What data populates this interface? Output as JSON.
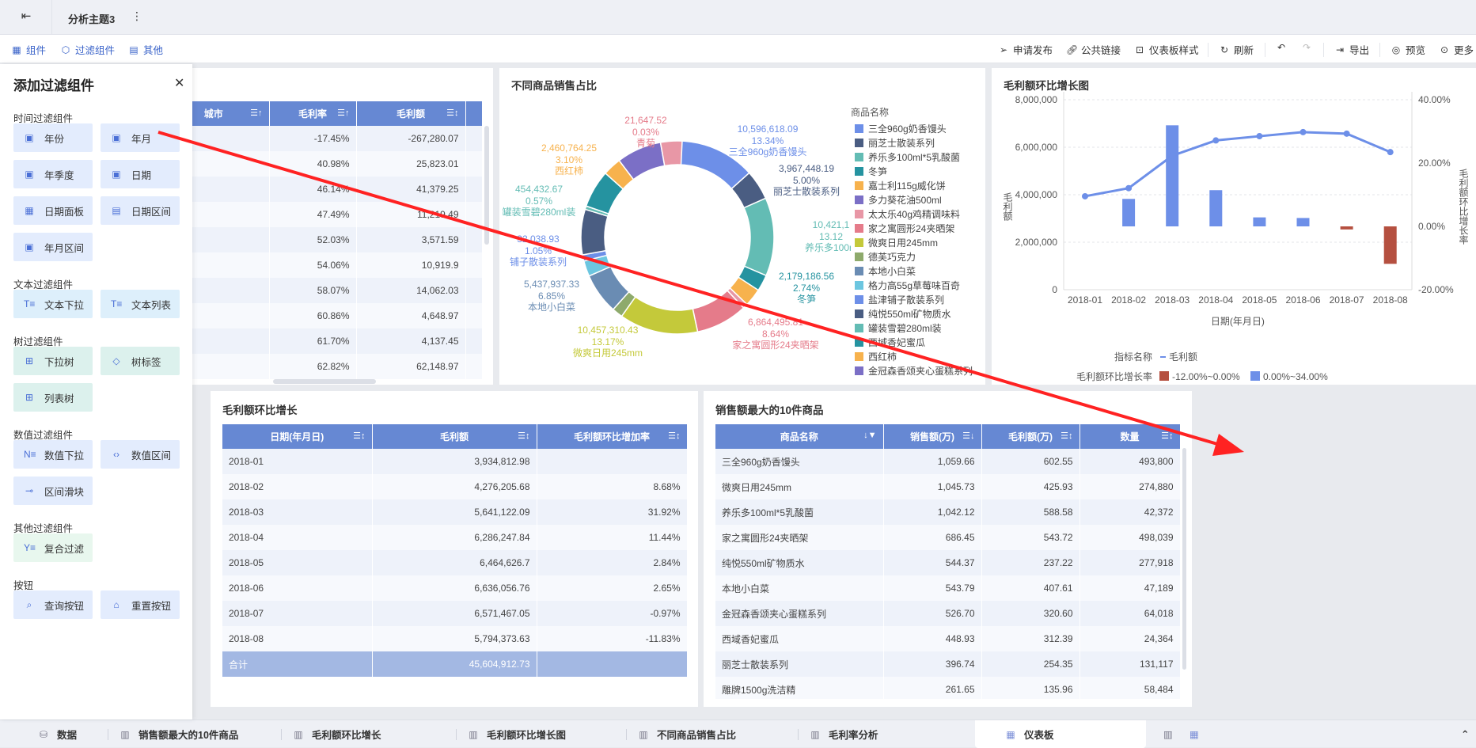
{
  "topbar": {
    "title": "分析主题3"
  },
  "toolbar": {
    "left": [
      "组件",
      "过滤组件",
      "其他"
    ],
    "right": {
      "publish": "申请发布",
      "public_link": "公共链接",
      "style": "仪表板样式",
      "refresh": "刷新",
      "export": "导出",
      "preview": "预览",
      "more": "更多"
    }
  },
  "sidebar": {
    "title": "添加过滤组件",
    "sections": [
      {
        "label": "时间过滤组件",
        "items": [
          "年份",
          "年月",
          "年季度",
          "日期",
          "日期面板",
          "日期区间",
          "年月区间"
        ]
      },
      {
        "label": "文本过滤组件",
        "items": [
          "文本下拉",
          "文本列表"
        ]
      },
      {
        "label": "树过滤组件",
        "items": [
          "下拉树",
          "树标签",
          "列表树"
        ]
      },
      {
        "label": "数值过滤组件",
        "items": [
          "数值下拉",
          "数值区间",
          "区间滑块"
        ]
      },
      {
        "label": "其他过滤组件",
        "items": [
          "复合过滤"
        ]
      },
      {
        "label": "按钮",
        "items": [
          "查询按钮",
          "重置按钮"
        ]
      }
    ]
  },
  "table_margin": {
    "headers": [
      "城市",
      "毛利率",
      "毛利额"
    ],
    "rows": [
      [
        "",
        "-17.45%",
        "-267,280.07"
      ],
      [
        "",
        "40.98%",
        "25,823.01"
      ],
      [
        "",
        "46.14%",
        "41,379.25"
      ],
      [
        "",
        "47.49%",
        "11,219.49"
      ],
      [
        "",
        "52.03%",
        "3,571.59"
      ],
      [
        "",
        "54.06%",
        "10,919.9"
      ],
      [
        "",
        "58.07%",
        "14,062.03"
      ],
      [
        "",
        "60.86%",
        "4,648.97"
      ],
      [
        "",
        "61.70%",
        "4,137.45"
      ],
      [
        "",
        "62.82%",
        "62,148.97"
      ]
    ]
  },
  "pie": {
    "title": "不同商品销售占比",
    "legend_title": "商品名称",
    "legend": [
      "三全960g奶香馒头",
      "丽芝士散装系列",
      "养乐多100ml*5乳酸菌",
      "冬笋",
      "嘉士利115g威化饼",
      "多力葵花油500ml",
      "太太乐40g鸡精调味料",
      "家之寓圆形24夹晒架",
      "微爽日用245mm",
      "德芙巧克力",
      "本地小白菜",
      "格力高55g草莓味百奇",
      "盐津铺子散装系列",
      "纯悦550ml矿物质水",
      "罐装雪碧280ml装",
      "西域香妃蜜瓜",
      "西红柿",
      "金冠森香颂夹心蛋糕系列"
    ],
    "labels": [
      {
        "value": "10,596,618.09",
        "pct": "13.34%",
        "name": "三全960g奶香馒头",
        "color": "#6d8fe8"
      },
      {
        "value": "3,967,448.19",
        "pct": "5.00%",
        "name": "丽芝士散装系列",
        "color": "#4a5d82"
      },
      {
        "value": "10,421,1",
        "pct": "13.12",
        "name": "养乐多100m",
        "color": "#63bcb4"
      },
      {
        "value": "2,179,186.56",
        "pct": "2.74%",
        "name": "冬笋",
        "color": "#2593a0"
      },
      {
        "value": "6,864,495.81",
        "pct": "8.64%",
        "name": "家之寓圆形24夹晒架",
        "color": "#e57b8a"
      },
      {
        "value": "10,457,310.43",
        "pct": "13.17%",
        "name": "微爽日用245mm",
        "color": "#c4c93a"
      },
      {
        "value": "5,437,937.33",
        "pct": "6.85%",
        "name": "本地小白菜",
        "color": "#6a8cb3"
      },
      {
        "value": "32,038.93",
        "pct": "1.05%",
        "name": "铺子散装系列",
        "color": "#6d8fe8"
      },
      {
        "value": "454,432.67",
        "pct": "0.57%",
        "name": "罐装雪碧280ml装",
        "color": "#63bcb4"
      },
      {
        "value": "2,460,764.25",
        "pct": "3.10%",
        "name": "西红柿",
        "color": "#f7b24d"
      },
      {
        "value": "21,647.52",
        "pct": "0.03%",
        "name": "青菊",
        "color": "#e57b8a"
      }
    ]
  },
  "chart_data": {
    "type": "bar+line",
    "title": "毛利额环比增长图",
    "categories": [
      "2018-01",
      "2018-02",
      "2018-03",
      "2018-04",
      "2018-05",
      "2018-06",
      "2018-07",
      "2018-08"
    ],
    "line": {
      "name": "毛利额",
      "values": [
        3934812.98,
        4276205.68,
        5641122.09,
        6286247.84,
        6464626.7,
        6636056.76,
        6571467.05,
        5794373.63
      ],
      "color": "#6d8fe8"
    },
    "bars": {
      "name": "毛利额环比增长率",
      "values": [
        null,
        8.68,
        31.92,
        11.44,
        2.84,
        2.65,
        -0.97,
        -11.83
      ]
    },
    "y_left": {
      "label": "毛利额",
      "ticks": [
        "8,000,000",
        "6,000,000",
        "4,000,000",
        "2,000,000",
        "0"
      ],
      "range": [
        0,
        8000000
      ]
    },
    "y_right": {
      "label": "毛利额环比增长率",
      "ticks": [
        "40.00%",
        "20.00%",
        "0.00%",
        "-20.00%"
      ],
      "range": [
        -20,
        40
      ]
    },
    "xlabel": "日期(年月日)",
    "legend": {
      "line_title": "指标名称",
      "line_name": "毛利额",
      "bar_title": "毛利额环比增长率",
      "neg_label": "-12.00%~0.00%",
      "pos_label": "0.00%~34.00%",
      "neg_color": "#b55040",
      "pos_color": "#6d8fe8"
    },
    "pie_slices": [
      {
        "name": "三全960g奶香馒头",
        "pct": 13.34,
        "color": "#6d8fe8"
      },
      {
        "name": "丽芝士散装系列",
        "pct": 5.0,
        "color": "#4a5d82"
      },
      {
        "name": "养乐多100ml*5乳酸菌",
        "pct": 13.12,
        "color": "#63bcb4"
      },
      {
        "name": "冬笋",
        "pct": 2.74,
        "color": "#2593a0"
      },
      {
        "name": "嘉士利115g威化饼",
        "pct": 3.0,
        "color": "#f7b24d"
      },
      {
        "name": "太太乐40g鸡精调味料",
        "pct": 0.8,
        "color": "#e897a6"
      },
      {
        "name": "家之寓圆形24夹晒架",
        "pct": 8.64,
        "color": "#e57b8a"
      },
      {
        "name": "微爽日用245mm",
        "pct": 13.17,
        "color": "#c4c93a"
      },
      {
        "name": "德芙巧克力",
        "pct": 1.8,
        "color": "#8eaa6c"
      },
      {
        "name": "本地小白菜",
        "pct": 6.85,
        "color": "#6a8cb3"
      },
      {
        "name": "格力高55g草莓味百奇",
        "pct": 2.6,
        "color": "#6cc6e0"
      },
      {
        "name": "盐津铺子散装系列",
        "pct": 1.05,
        "color": "#6d8fe8"
      },
      {
        "name": "纯悦550ml矿物质水",
        "pct": 7.6,
        "color": "#4a5d82"
      },
      {
        "name": "罐装雪碧280ml装",
        "pct": 0.57,
        "color": "#63bcb4"
      },
      {
        "name": "西域香妃蜜瓜",
        "pct": 6.3,
        "color": "#2593a0"
      },
      {
        "name": "西红柿",
        "pct": 3.1,
        "color": "#f7b24d"
      },
      {
        "name": "金冠森香颂夹心蛋糕系列",
        "pct": 7.5,
        "color": "#7b6fc6"
      },
      {
        "name": "青菊",
        "pct": 3.6,
        "color": "#e897a6"
      }
    ]
  },
  "table_growth": {
    "title": "毛利额环比增长",
    "headers": [
      "日期(年月日)",
      "毛利额",
      "毛利额环比增加率"
    ],
    "rows": [
      [
        "2018-01",
        "3,934,812.98",
        ""
      ],
      [
        "2018-02",
        "4,276,205.68",
        "8.68%"
      ],
      [
        "2018-03",
        "5,641,122.09",
        "31.92%"
      ],
      [
        "2018-04",
        "6,286,247.84",
        "11.44%"
      ],
      [
        "2018-05",
        "6,464,626.7",
        "2.84%"
      ],
      [
        "2018-06",
        "6,636,056.76",
        "2.65%"
      ],
      [
        "2018-07",
        "6,571,467.05",
        "-0.97%"
      ],
      [
        "2018-08",
        "5,794,373.63",
        "-11.83%"
      ]
    ],
    "total": [
      "合计",
      "45,604,912.73",
      ""
    ]
  },
  "table_top10": {
    "title": "销售额最大的10件商品",
    "headers": [
      "商品名称",
      "销售额(万)",
      "毛利额(万)",
      "数量"
    ],
    "rows": [
      [
        "三全960g奶香馒头",
        "1,059.66",
        "602.55",
        "493,800"
      ],
      [
        "微爽日用245mm",
        "1,045.73",
        "425.93",
        "274,880"
      ],
      [
        "养乐多100ml*5乳酸菌",
        "1,042.12",
        "588.58",
        "42,372"
      ],
      [
        "家之寓圆形24夹晒架",
        "686.45",
        "543.72",
        "498,039"
      ],
      [
        "纯悦550ml矿物质水",
        "544.37",
        "237.22",
        "277,918"
      ],
      [
        "本地小白菜",
        "543.79",
        "407.61",
        "47,189"
      ],
      [
        "金冠森香颂夹心蛋糕系列",
        "526.70",
        "320.60",
        "64,018"
      ],
      [
        "西域香妃蜜瓜",
        "448.93",
        "312.39",
        "24,364"
      ],
      [
        "丽芝士散装系列",
        "396.74",
        "254.35",
        "131,117"
      ],
      [
        "雕牌1500g洗洁精",
        "261.65",
        "135.96",
        "58,484"
      ]
    ]
  },
  "bottom_tabs": [
    "数据",
    "销售额最大的10件商品",
    "毛利额环比增长",
    "毛利额环比增长图",
    "不同商品销售占比",
    "毛利率分析",
    "仪表板"
  ]
}
